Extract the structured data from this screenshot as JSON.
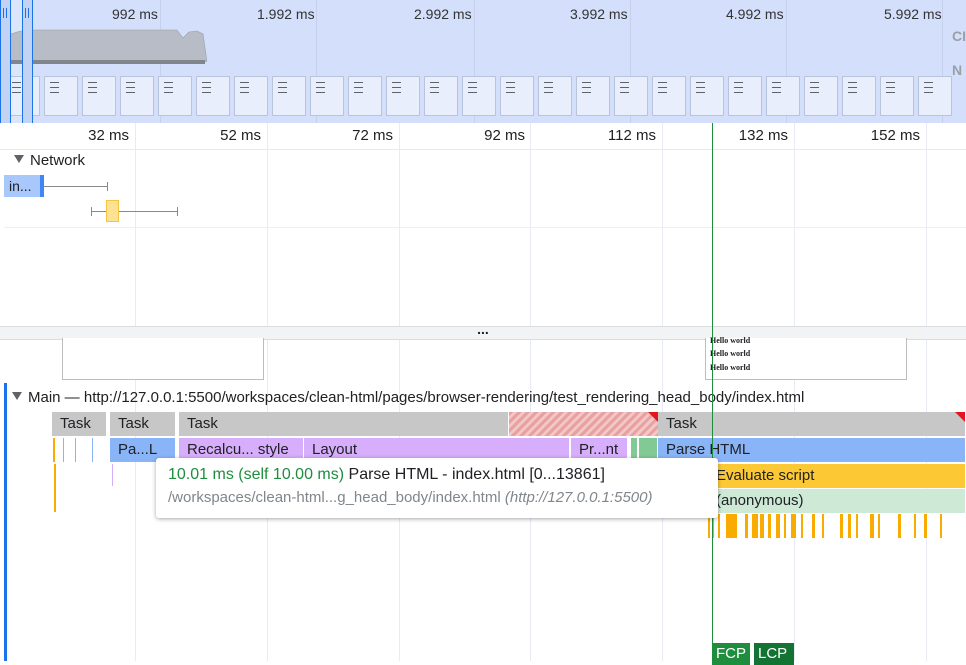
{
  "overview": {
    "ticks": [
      "992 ms",
      "1.992 ms",
      "2.992 ms",
      "3.992 ms",
      "4.992 ms",
      "5.992 ms"
    ],
    "right_labels": [
      "CI",
      "N"
    ]
  },
  "ruler": {
    "ticks": [
      "32 ms",
      "52 ms",
      "72 ms",
      "92 ms",
      "112 ms",
      "132 ms",
      "152 ms"
    ]
  },
  "network": {
    "title": "Network",
    "request_label": "in..."
  },
  "splitter": {
    "label": "..."
  },
  "screenshots": {
    "frame_lines": [
      "Hello world",
      "Hello world",
      "Hello world"
    ]
  },
  "main": {
    "title": "Main — http://127.0.0.1:5500/workspaces/clean-html/pages/browser-rendering/test_rendering_head_body/index.html",
    "tasks": [
      "Task",
      "Task",
      "Task",
      "Task"
    ],
    "events": {
      "parse_short": "Pa...L",
      "recalc": "Recalcu... style",
      "layout": "Layout",
      "paint": "Pr...nt",
      "parse_html": "Parse HTML",
      "evaluate_script": "Evaluate script",
      "anonymous": "(anonymous)"
    },
    "markers": {
      "fcp": "FCP",
      "lcp": "LCP"
    }
  },
  "tooltip": {
    "duration": "10.01 ms (self 10.00 ms)",
    "title": "Parse HTML - index.html [0...13861]",
    "url": "/workspaces/clean-html...g_head_body/index.html",
    "origin": "(http://127.0.0.1:5500)"
  },
  "colors": {
    "task": "#c7c7c7",
    "loading": "#8ab4f8",
    "rendering": "#d7aefb",
    "painting": "#81c995",
    "scripting": "#fcc934",
    "fcp": "#1e8e3e",
    "lcp": "#137333"
  }
}
